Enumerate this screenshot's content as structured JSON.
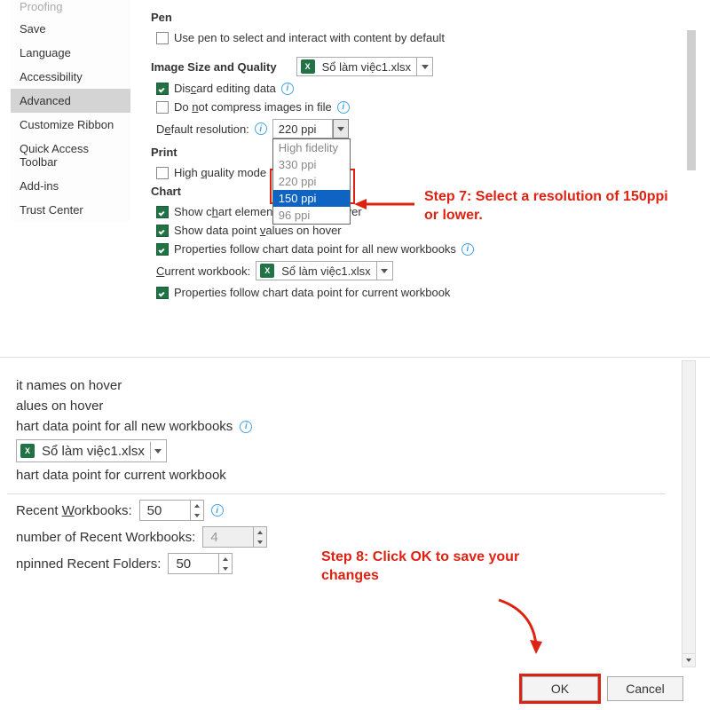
{
  "sidebar": {
    "items": [
      {
        "label": "Proofing",
        "partial": true
      },
      {
        "label": "Save"
      },
      {
        "label": "Language"
      },
      {
        "label": "Accessibility"
      },
      {
        "label": "Advanced",
        "selected": true
      },
      {
        "label": "Customize Ribbon"
      },
      {
        "label": "Quick Access Toolbar"
      },
      {
        "label": "Add-ins"
      },
      {
        "label": "Trust Center"
      }
    ]
  },
  "pen": {
    "title": "Pen",
    "use_pen_label": "Use pen to select and interact with content by default"
  },
  "image_quality": {
    "title": "Image Size and Quality",
    "workbook": "Sổ làm việc1.xlsx",
    "discard_label": "Discard editing data",
    "no_compress_label": "Do not compress images in file",
    "default_res_label": "Default resolution:",
    "default_res_value": "220 ppi",
    "options": [
      "High fidelity",
      "330 ppi",
      "220 ppi",
      "150 ppi",
      "96 ppi"
    ],
    "highlighted": "150 ppi"
  },
  "print": {
    "title": "Print",
    "high_quality_label": "High quality mode"
  },
  "chart": {
    "title": "Chart",
    "hover_names": "Show chart element names on hover",
    "hover_values": "Show data point values on hover",
    "props_all": "Properties follow chart data point for all new workbooks",
    "current_label": "Current workbook:",
    "current_value": "Sổ làm việc1.xlsx",
    "props_current": "Properties follow chart data point for current workbook"
  },
  "annotations": {
    "step7": "Step 7: Select a resolution of 150ppi or lower.",
    "step8": "Step 8: Click OK to save your changes"
  },
  "bottom_fragment": {
    "l1": "it names on hover",
    "l2": "alues on hover",
    "l3": "hart data point for all new workbooks",
    "l4_wb": "Sổ làm việc1.xlsx",
    "l5": "hart data point for current workbook",
    "recent_wb_label": "Recent Workbooks:",
    "recent_wb_val": "50",
    "num_recent_label": "number of Recent Workbooks:",
    "num_recent_val": "4",
    "unpinned_label": "npinned Recent Folders:",
    "unpinned_val": "50"
  },
  "buttons": {
    "ok": "OK",
    "cancel": "Cancel"
  }
}
